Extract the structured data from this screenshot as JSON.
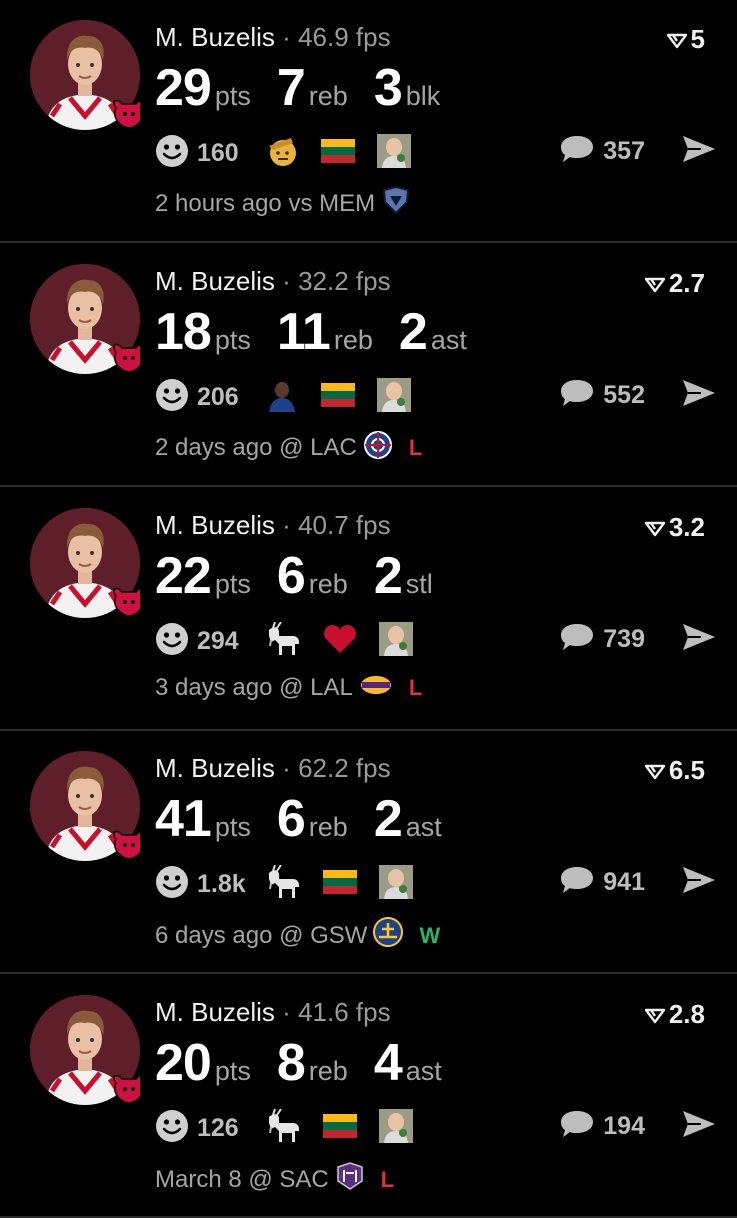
{
  "colors": {
    "loss": "#e0303a",
    "win": "#28b463",
    "bulls_red": "#ce1141",
    "avatar_bg": "#5e1f2b"
  },
  "icons": {
    "reaction": "smiley-icon",
    "comment": "comment-bubble-icon",
    "share": "send-arrow-icon",
    "score": "fantasy-score-icon"
  },
  "posts": [
    {
      "player": "M. Buzelis",
      "sep": "·",
      "fps": "46.9 fps",
      "score": "5",
      "stats": [
        {
          "num": "29",
          "unit": "pts"
        },
        {
          "num": "7",
          "unit": "reb"
        },
        {
          "num": "3",
          "unit": "blk"
        }
      ],
      "reactions": "160",
      "badges": [
        "saluting-face-icon",
        "lithuania-flag-icon",
        "success-kid-icon"
      ],
      "comments": "357",
      "time": "2 hours ago",
      "venue": "vs MEM",
      "team_logo": "grizzlies-logo",
      "result": ""
    },
    {
      "player": "M. Buzelis",
      "sep": "·",
      "fps": "32.2 fps",
      "score": "2.7",
      "stats": [
        {
          "num": "18",
          "unit": "pts"
        },
        {
          "num": "11",
          "unit": "reb"
        },
        {
          "num": "2",
          "unit": "ast"
        }
      ],
      "reactions": "206",
      "badges": [
        "player-avatar-icon",
        "lithuania-flag-icon",
        "success-kid-icon"
      ],
      "comments": "552",
      "time": "2 days ago",
      "venue": "@ LAC",
      "team_logo": "clippers-logo",
      "result": "L"
    },
    {
      "player": "M. Buzelis",
      "sep": "·",
      "fps": "40.7 fps",
      "score": "3.2",
      "stats": [
        {
          "num": "22",
          "unit": "pts"
        },
        {
          "num": "6",
          "unit": "reb"
        },
        {
          "num": "2",
          "unit": "stl"
        }
      ],
      "reactions": "294",
      "badges": [
        "goat-icon",
        "heart-icon",
        "success-kid-icon"
      ],
      "comments": "739",
      "time": "3 days ago",
      "venue": "@ LAL",
      "team_logo": "lakers-logo",
      "result": "L"
    },
    {
      "player": "M. Buzelis",
      "sep": "·",
      "fps": "62.2 fps",
      "score": "6.5",
      "stats": [
        {
          "num": "41",
          "unit": "pts"
        },
        {
          "num": "6",
          "unit": "reb"
        },
        {
          "num": "2",
          "unit": "ast"
        }
      ],
      "reactions": "1.8k",
      "badges": [
        "goat-icon",
        "lithuania-flag-icon",
        "success-kid-icon"
      ],
      "comments": "941",
      "time": "6 days ago",
      "venue": "@ GSW",
      "team_logo": "warriors-logo",
      "result": "W"
    },
    {
      "player": "M. Buzelis",
      "sep": "·",
      "fps": "41.6 fps",
      "score": "2.8",
      "stats": [
        {
          "num": "20",
          "unit": "pts"
        },
        {
          "num": "8",
          "unit": "reb"
        },
        {
          "num": "4",
          "unit": "ast"
        }
      ],
      "reactions": "126",
      "badges": [
        "goat-icon",
        "lithuania-flag-icon",
        "success-kid-icon"
      ],
      "comments": "194",
      "time": "March 8",
      "venue": "@ SAC",
      "team_logo": "kings-logo",
      "result": "L"
    }
  ]
}
